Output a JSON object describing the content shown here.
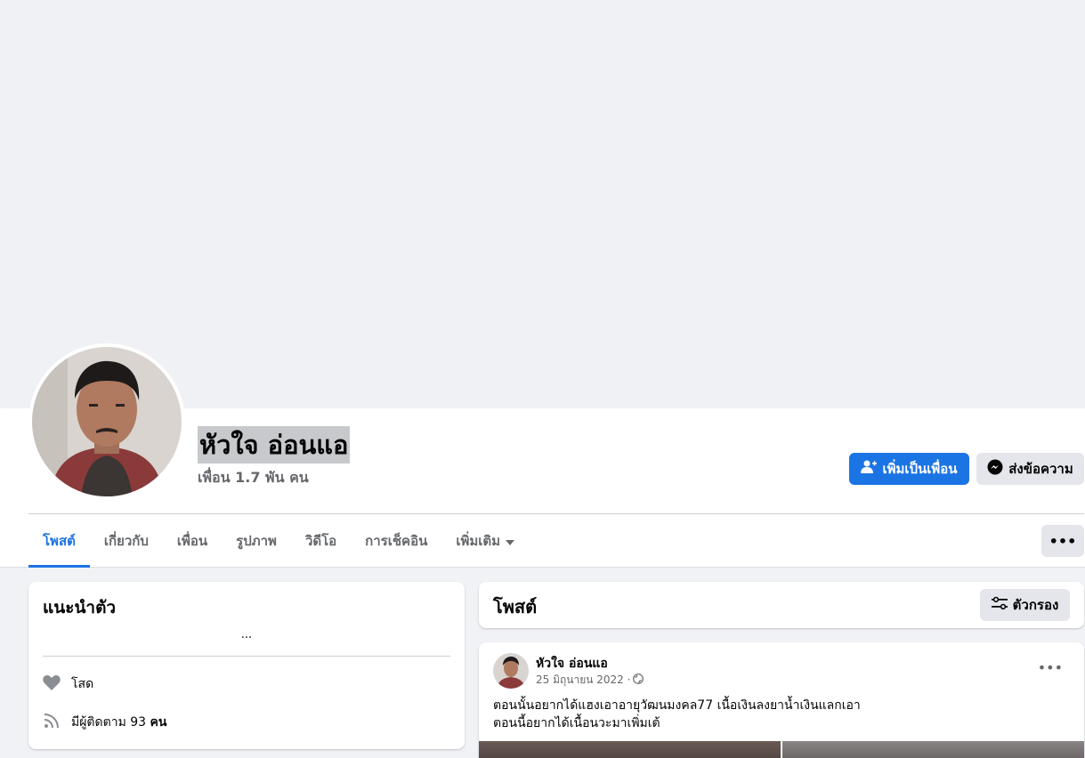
{
  "profile": {
    "name": "หัวใจ อ่อนแอ",
    "friends_count": "เพื่อน 1.7 พัน คน"
  },
  "actions": {
    "add_friend": "เพิ่มเป็นเพื่อน",
    "message": "ส่งข้อความ",
    "more": "•••"
  },
  "tabs": [
    {
      "label": "โพสต์",
      "active": true
    },
    {
      "label": "เกี่ยวกับ"
    },
    {
      "label": "เพื่อน"
    },
    {
      "label": "รูปภาพ"
    },
    {
      "label": "วิดีโอ"
    },
    {
      "label": "การเช็คอิน"
    },
    {
      "label": "เพิ่มเติม"
    }
  ],
  "intro": {
    "title": "แนะนำตัว",
    "bio_placeholder": "...",
    "relationship": "โสด",
    "followers_prefix": "มีผู้ติดตาม 93 ",
    "followers_suffix": "คน"
  },
  "posts": {
    "title": "โพสต์",
    "filter_label": "ตัวกรอง",
    "items": [
      {
        "author": "หัวใจ อ่อนแอ",
        "date": "25 มิถุนายน 2022 ·",
        "more": "•••",
        "line1": "ตอนนั้นอยากได้แฮงเอาอายุวัฒนมงคล77 เนื้อเงินลงยาน้ำเงินแลกเอา",
        "line2": "ตอนนี้อยากได้เนื้อนวะมาเพิ่มเต้"
      }
    ]
  },
  "colors": {
    "accent": "#1b74e4",
    "secondary_text": "#65676b"
  }
}
